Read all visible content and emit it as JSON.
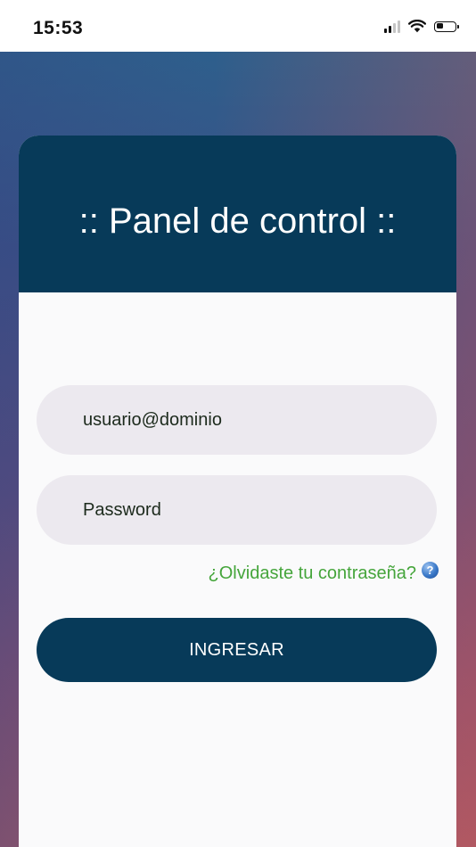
{
  "status_bar": {
    "time": "15:53",
    "icons": [
      "signal-icon",
      "wifi-icon",
      "battery-icon"
    ]
  },
  "login": {
    "title": ":: Panel de control ::",
    "username_placeholder": "usuario@dominio",
    "password_placeholder": "Password",
    "forgot_password_label": "¿Olvidaste tu contraseña?",
    "help_icon_glyph": "?",
    "submit_label": "INGRESAR"
  },
  "colors": {
    "header_bg": "#073a59",
    "button_bg": "#073a59",
    "field_bg": "#ece9ef",
    "link": "#45a53b"
  }
}
